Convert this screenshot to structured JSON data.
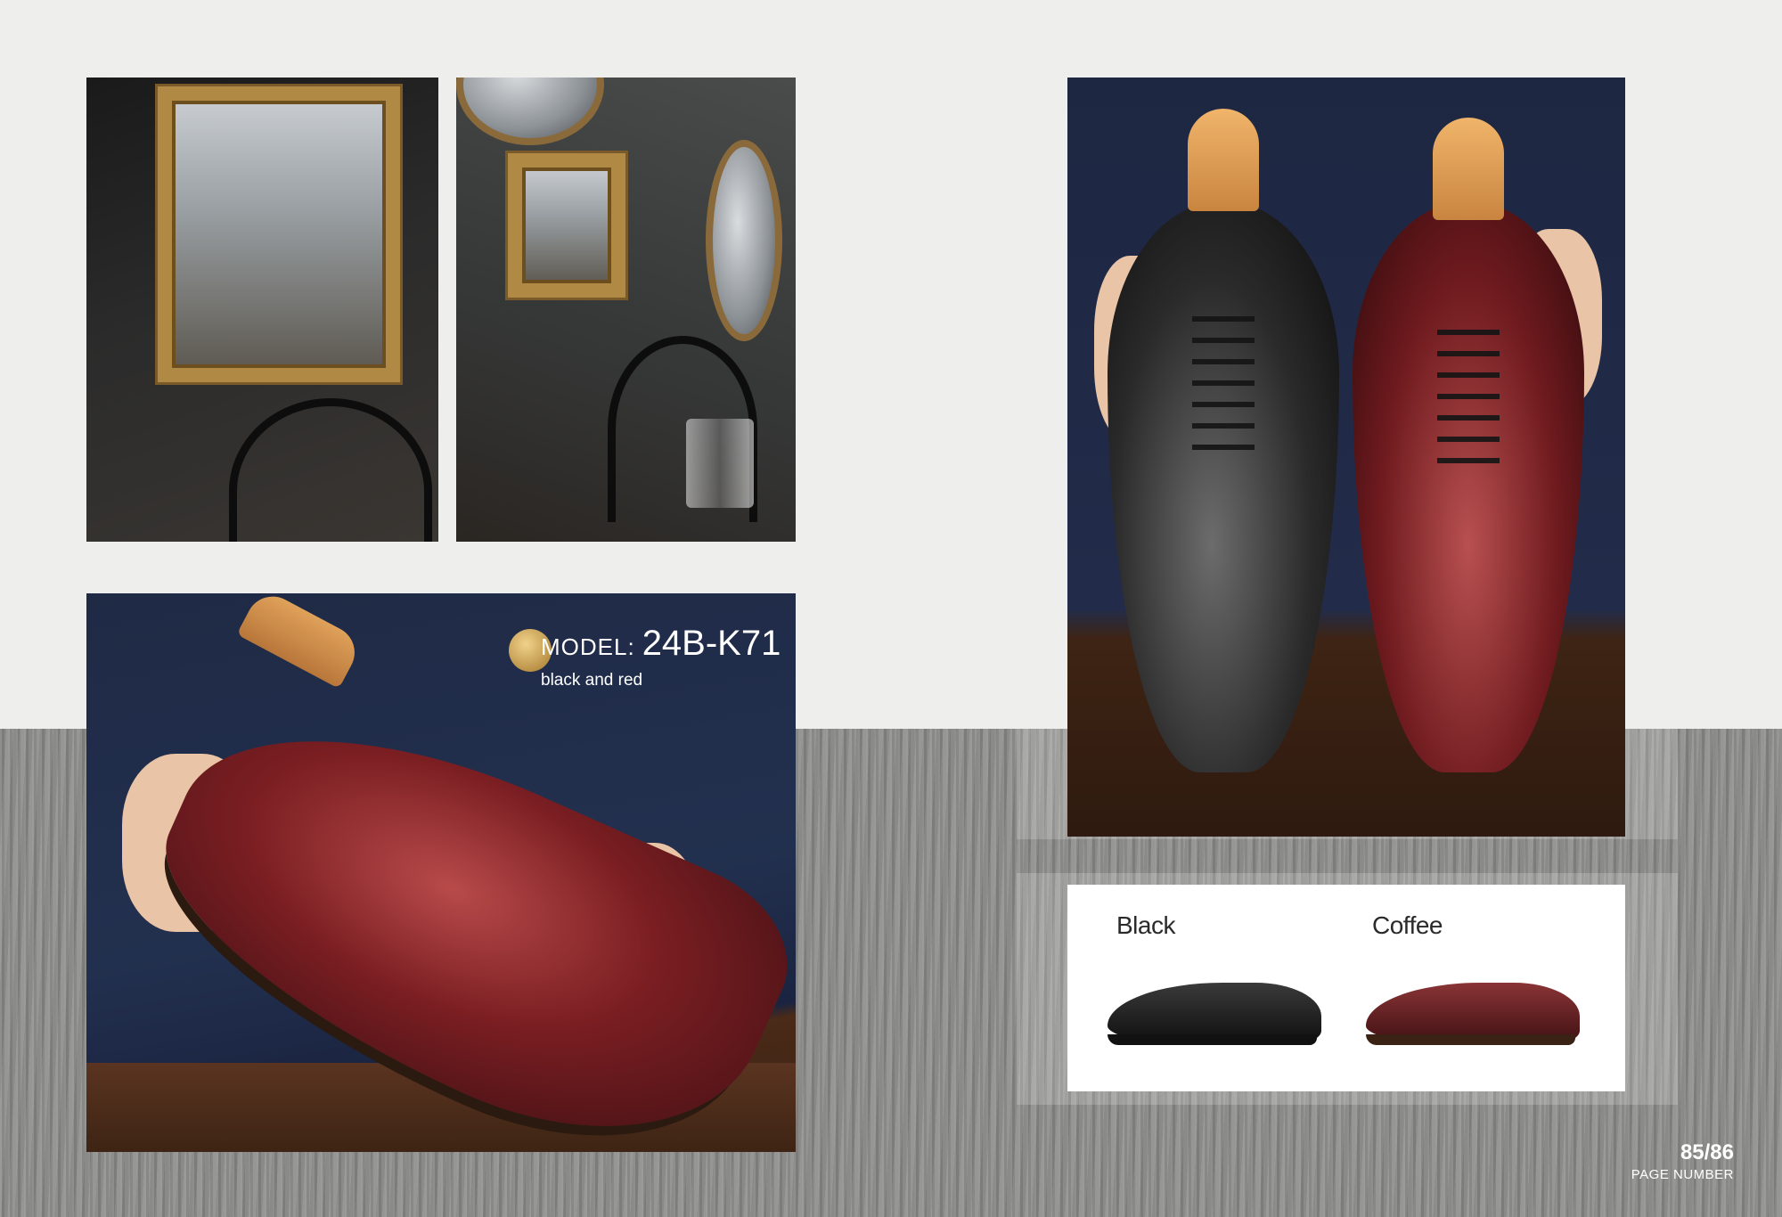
{
  "model": {
    "prefix": "MODEL:",
    "code": "24B-K71",
    "color_description": "black and red"
  },
  "variants": [
    {
      "label": "Black",
      "swatch": "#1c1c1c"
    },
    {
      "label": "Coffee",
      "swatch": "#5a1a1c"
    }
  ],
  "page": {
    "number": "85/86",
    "label": "PAGE NUMBER"
  },
  "colors": {
    "background": "#eeeeec",
    "wood_band": "#8c8c8a",
    "burgundy": "#7a1e22",
    "navy": "#1f2a45"
  }
}
